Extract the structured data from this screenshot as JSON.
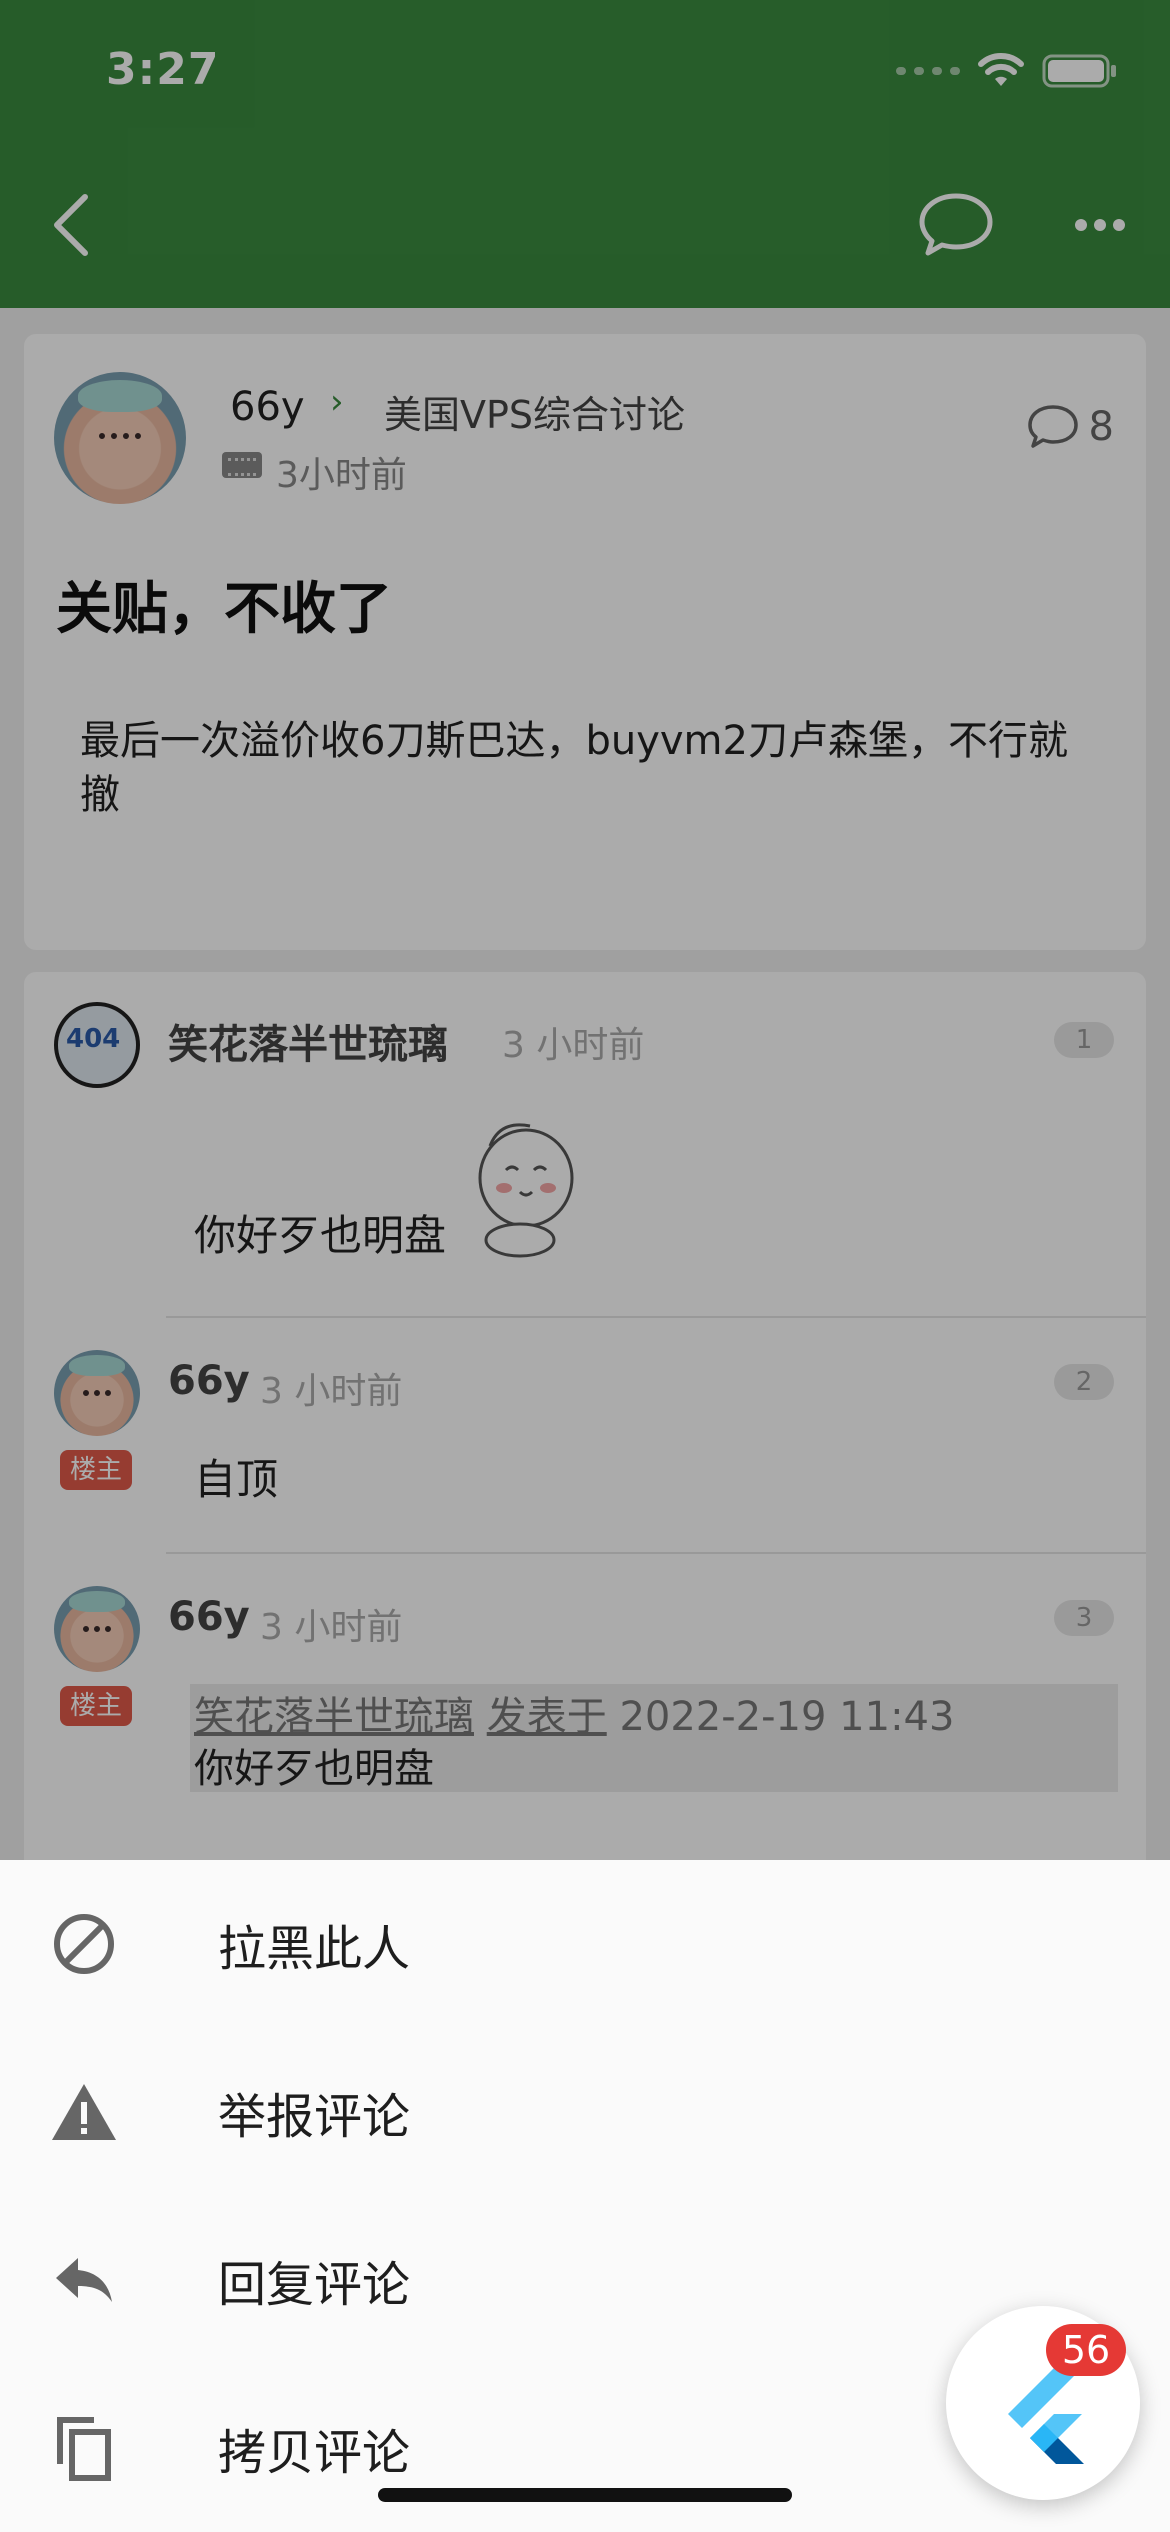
{
  "status_bar": {
    "time": "3:27"
  },
  "post": {
    "author": "66y",
    "node": "美国VPS综合讨论",
    "time": "3小时前",
    "comment_count": "8",
    "title": "关贴，不收了",
    "body": "最后一次溢价收6刀斯巴达，buyvm2刀卢森堡，不行就撤"
  },
  "comments": [
    {
      "author": "笑花落半世琉璃",
      "time": "3 小时前",
      "floor": "1",
      "text": "你好歹也明盘"
    },
    {
      "author": "66y",
      "time": "3 小时前",
      "floor": "2",
      "badge": "楼主",
      "text": "自顶"
    },
    {
      "author": "66y",
      "time": "3 小时前",
      "floor": "3",
      "badge": "楼主",
      "quote_author": "笑花落半世琉璃",
      "quote_posted": "发表于",
      "quote_date": "2022-2-19 11:43",
      "quote_text": "你好歹也明盘"
    }
  ],
  "sheet": {
    "items": [
      {
        "label": "拉黑此人",
        "icon": "block-icon"
      },
      {
        "label": "举报评论",
        "icon": "warning-icon"
      },
      {
        "label": "回复评论",
        "icon": "reply-icon"
      },
      {
        "label": "拷贝评论",
        "icon": "copy-icon"
      }
    ]
  },
  "debug_fab": {
    "badge": "56",
    "icon": "flutter-logo-icon"
  },
  "colors": {
    "app_bar": "#3a8a3e",
    "badge": "#e05a4a",
    "fab_badge": "#e53935"
  }
}
